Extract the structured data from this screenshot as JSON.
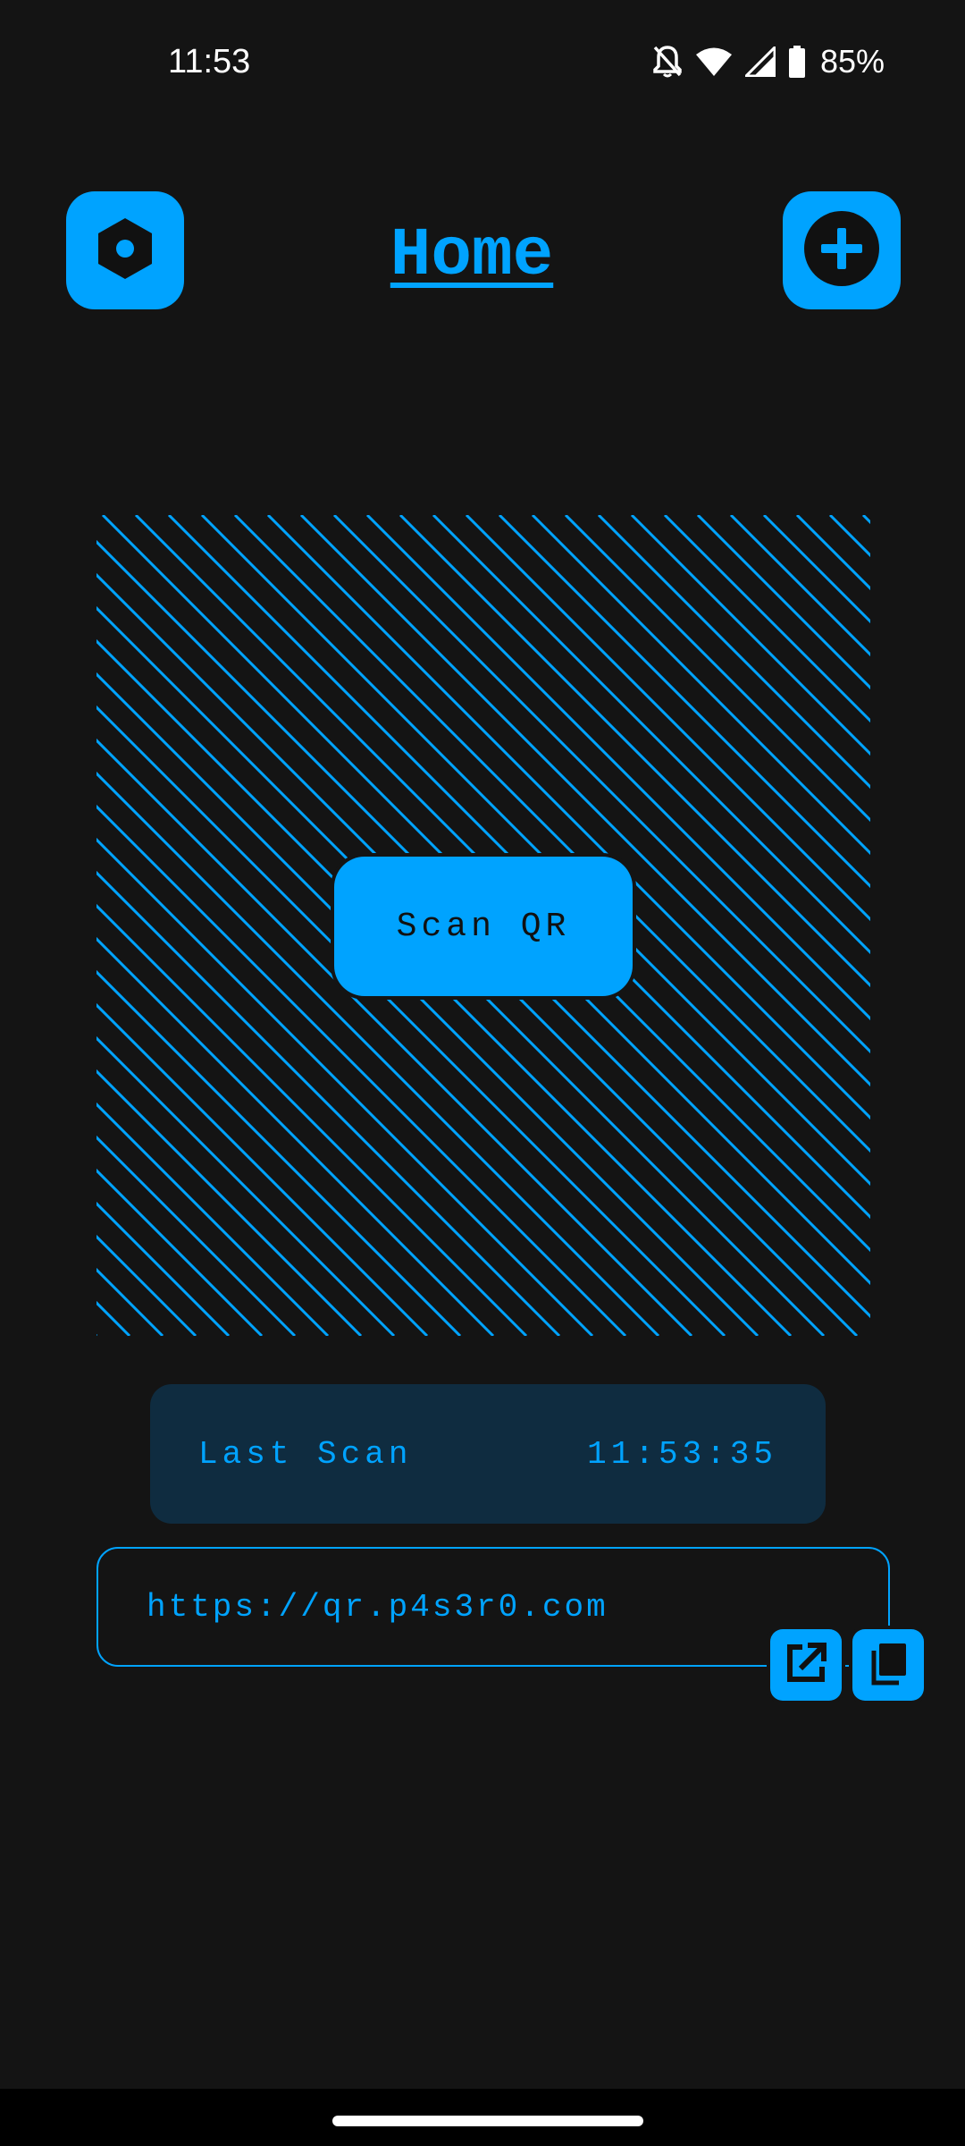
{
  "status_bar": {
    "time": "11:53",
    "battery_percent": "85%",
    "icons": [
      "notifications-off-icon",
      "wifi-icon",
      "signal-icon",
      "battery-icon"
    ]
  },
  "header": {
    "title": "Home",
    "left_icon": "settings-hex-icon",
    "right_icon": "add-circle-icon"
  },
  "scanner": {
    "button_label": "Scan QR"
  },
  "last_scan": {
    "label": "Last Scan",
    "time": "11:53:35"
  },
  "result": {
    "url": "https://qr.p4s3r0.com",
    "actions": [
      "open-external-icon",
      "copy-icon"
    ]
  },
  "colors": {
    "accent": "#00a3ff",
    "background": "#141414",
    "card": "#0f2c40"
  }
}
